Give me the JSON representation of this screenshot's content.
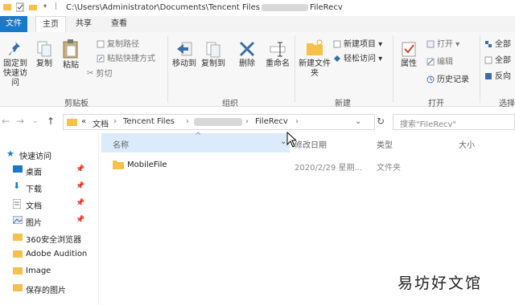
{
  "titlebar": {
    "path_prefix": "C:\\Users\\Administrator\\Documents\\Tencent Files",
    "path_suffix": "FileRecv"
  },
  "tabs": {
    "file": "文件",
    "home": "主页",
    "share": "共享",
    "view": "查看"
  },
  "ribbon": {
    "pin_label": "固定到快速访问",
    "copy": "复制",
    "paste": "粘贴",
    "copy_path": "复制路径",
    "paste_shortcut": "粘贴快捷方式",
    "cut": "剪切",
    "clipboard_group": "剪贴板",
    "move_to": "移动到",
    "copy_to": "复制到",
    "delete": "删除",
    "rename": "重命名",
    "organize_group": "组织",
    "new_folder": "新建文件夹",
    "new_item": "新建项目",
    "easy_access": "轻松访问",
    "new_group": "新建",
    "properties": "属性",
    "open": "打开",
    "edit": "编辑",
    "history": "历史记录",
    "open_group": "打开",
    "select_all": "全部",
    "select_none": "全部",
    "invert": "反向",
    "select_group": "选择"
  },
  "address": {
    "overflow": "«",
    "crumb1": "文档",
    "crumb2": "Tencent Files",
    "crumb4": "FileRecv",
    "search_placeholder": "搜索\"FileRecv\""
  },
  "nav": {
    "quick_access": "快速访问",
    "items": [
      {
        "label": "桌面"
      },
      {
        "label": "下载"
      },
      {
        "label": "文档"
      },
      {
        "label": "图片"
      },
      {
        "label": "360安全浏览器"
      },
      {
        "label": "Adobe Audition"
      },
      {
        "label": "Image"
      },
      {
        "label": "保存的图片"
      }
    ]
  },
  "columns": {
    "name": "名称",
    "date": "修改日期",
    "type": "类型",
    "size": "大小"
  },
  "files": [
    {
      "name": "MobileFile",
      "date": "2020/2/29 星期...",
      "type": "文件夹",
      "size": ""
    }
  ],
  "watermark": "易坊好文馆",
  "colors": {
    "accent": "#1979ca",
    "folder": "#f5c14a",
    "selected_header": "#dcebfb"
  }
}
